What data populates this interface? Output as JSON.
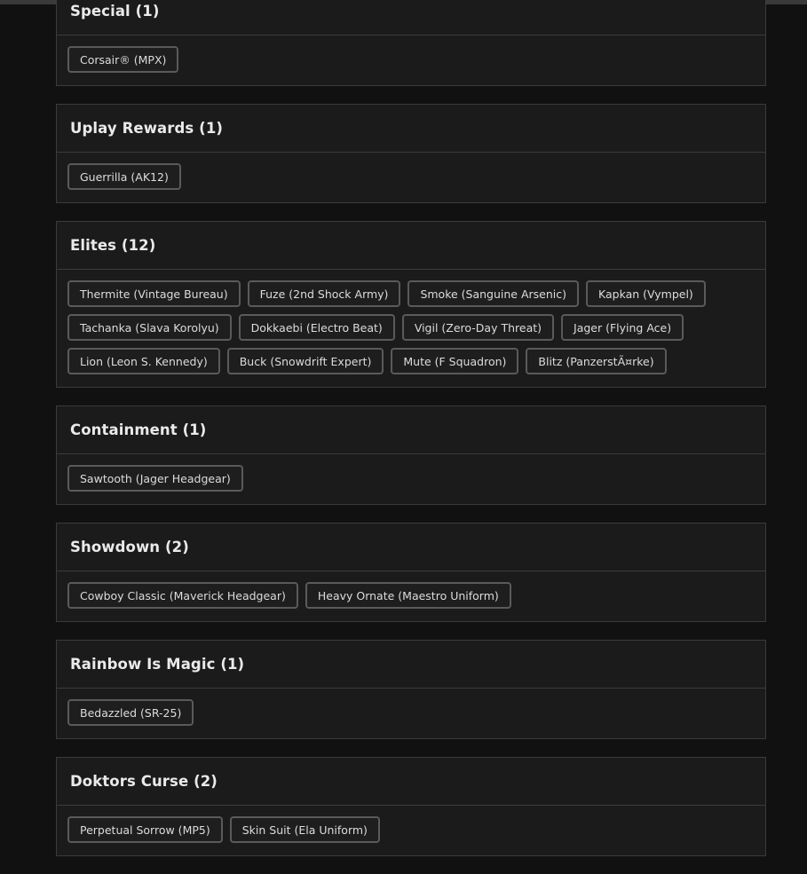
{
  "sections": [
    {
      "title": "Special (1)",
      "items": [
        "Corsair® (MPX)"
      ]
    },
    {
      "title": "Uplay Rewards (1)",
      "items": [
        "Guerrilla (AK12)"
      ]
    },
    {
      "title": "Elites (12)",
      "items": [
        "Thermite (Vintage Bureau)",
        "Fuze (2nd Shock Army)",
        "Smoke (Sanguine Arsenic)",
        "Kapkan (Vympel)",
        "Tachanka (Slava Korolyu)",
        "Dokkaebi (Electro Beat)",
        "Vigil (Zero-Day Threat)",
        "Jager (Flying Ace)",
        "Lion (Leon S. Kennedy)",
        "Buck (Snowdrift Expert)",
        "Mute (F Squadron)",
        "Blitz (PanzerstÃ¤rke)"
      ]
    },
    {
      "title": "Containment (1)",
      "items": [
        "Sawtooth (Jager Headgear)"
      ]
    },
    {
      "title": "Showdown (2)",
      "items": [
        "Cowboy Classic (Maverick Headgear)",
        "Heavy Ornate (Maestro Uniform)"
      ]
    },
    {
      "title": "Rainbow Is Magic (1)",
      "items": [
        "Bedazzled (SR-25)"
      ]
    },
    {
      "title": "Doktors Curse (2)",
      "items": [
        "Perpetual Sorrow (MP5)",
        "Skin Suit (Ela Uniform)"
      ]
    }
  ]
}
